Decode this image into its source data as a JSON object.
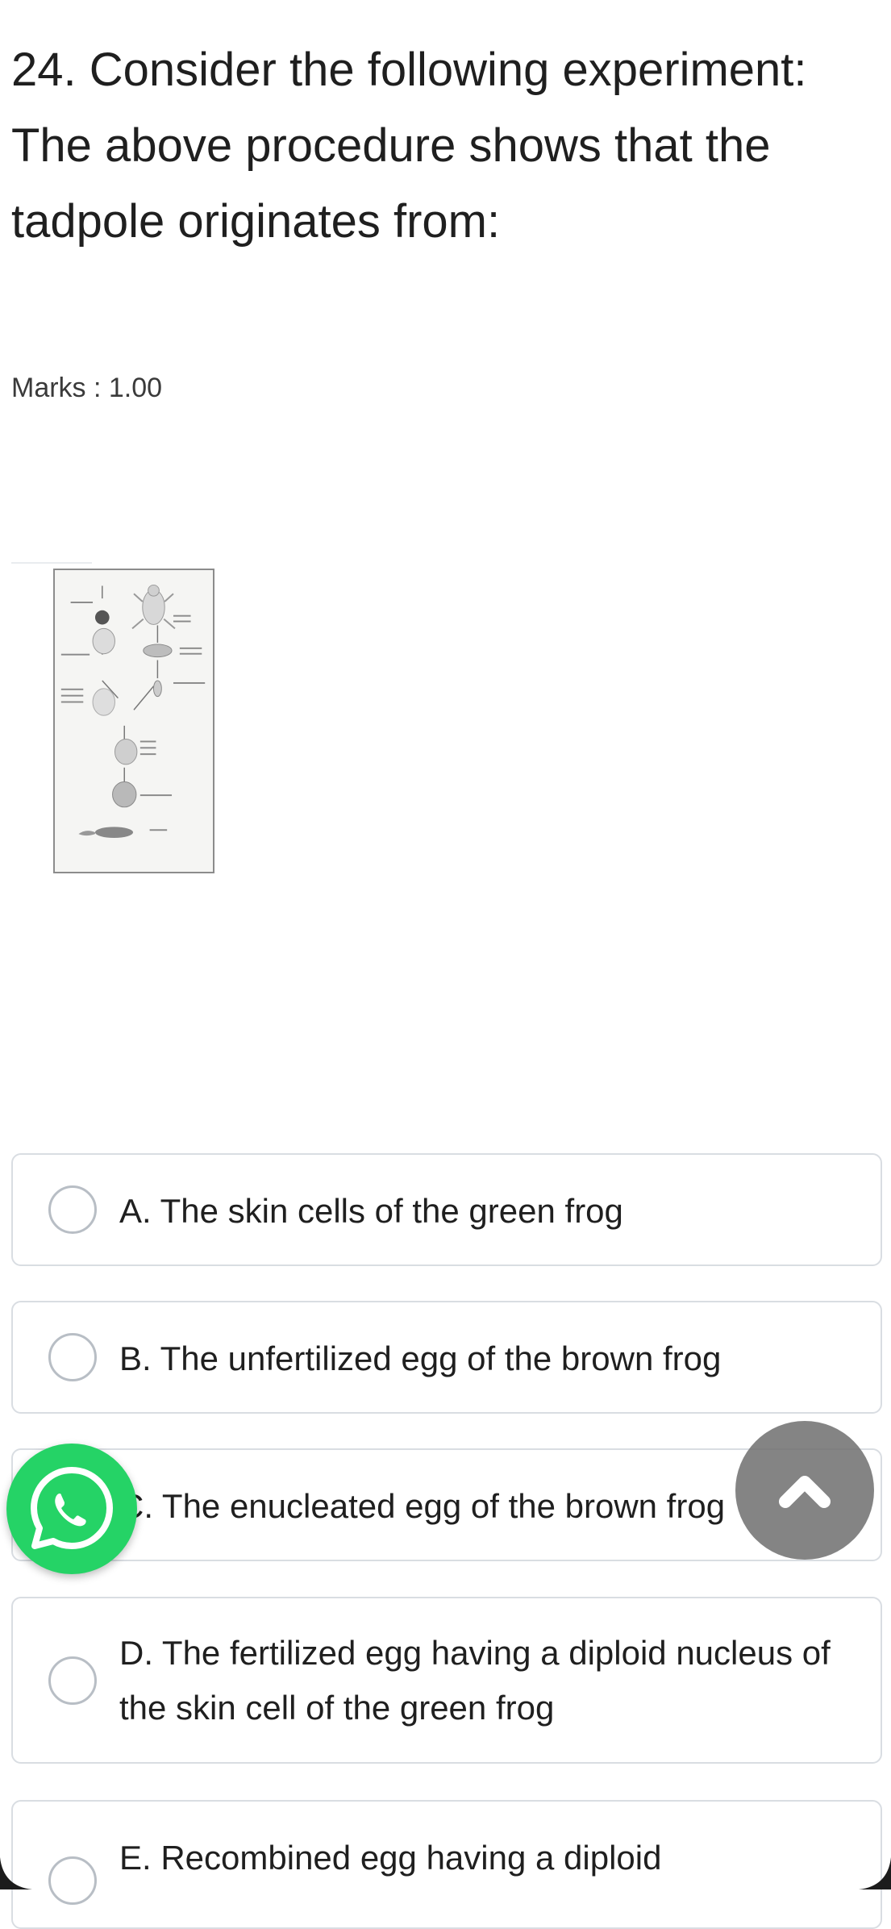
{
  "question": {
    "text": "24. Consider the following experiment: The above procedure shows that the tadpole originates from:",
    "marks": "Marks : 1.00"
  },
  "options": [
    {
      "label": "A. The skin cells of the green frog"
    },
    {
      "label": "B. The unfertilized egg of the brown frog"
    },
    {
      "label": "C. The enucleated egg of the brown frog"
    },
    {
      "label": "D. The fertilized egg having a diploid nucleus of the skin cell of the green frog"
    },
    {
      "label": "E. Recombined egg having a diploid"
    }
  ],
  "floating": {
    "whatsapp_icon": "whatsapp-icon",
    "scroll_top_icon": "chevron-up-icon",
    "whatsapp_color": "#25d366"
  }
}
